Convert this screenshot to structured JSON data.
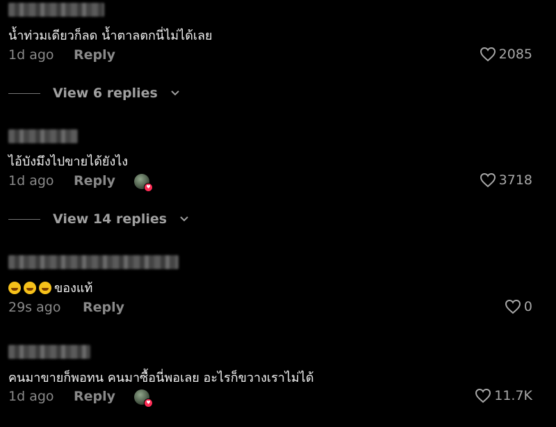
{
  "comments": [
    {
      "text": "น้ำท่วมเดียวก็ลด น้ำตาลตกนี่ไม่ได้เลย",
      "time": "1d ago",
      "reply_label": "Reply",
      "likes": "2085",
      "creator_liked": false,
      "view_replies": "View 6 replies"
    },
    {
      "text": "ไอ้บังมึงไปขายได้ยังไง",
      "time": "1d ago",
      "reply_label": "Reply",
      "likes": "3718",
      "creator_liked": true,
      "view_replies": "View 14 replies"
    },
    {
      "text": "ของแท้",
      "emoji_prefix": [
        "face-with-tears-of-joy",
        "face-with-tears-of-joy",
        "face-with-tears-of-joy"
      ],
      "time": "29s ago",
      "reply_label": "Reply",
      "likes": "0",
      "creator_liked": false
    },
    {
      "text": "คนมาขายก็พอทน คนมาซื้อนี่พอเลย อะไรก็ขวางเราไม่ได้",
      "time": "1d ago",
      "reply_label": "Reply",
      "likes": "11.7K",
      "creator_liked": true
    }
  ],
  "colors": {
    "background": "#000000",
    "muted": "#8a8a8a",
    "badge": "#fe2c55"
  },
  "icons": {
    "like": "heart-outline-icon",
    "expand": "chevron-down-icon"
  }
}
